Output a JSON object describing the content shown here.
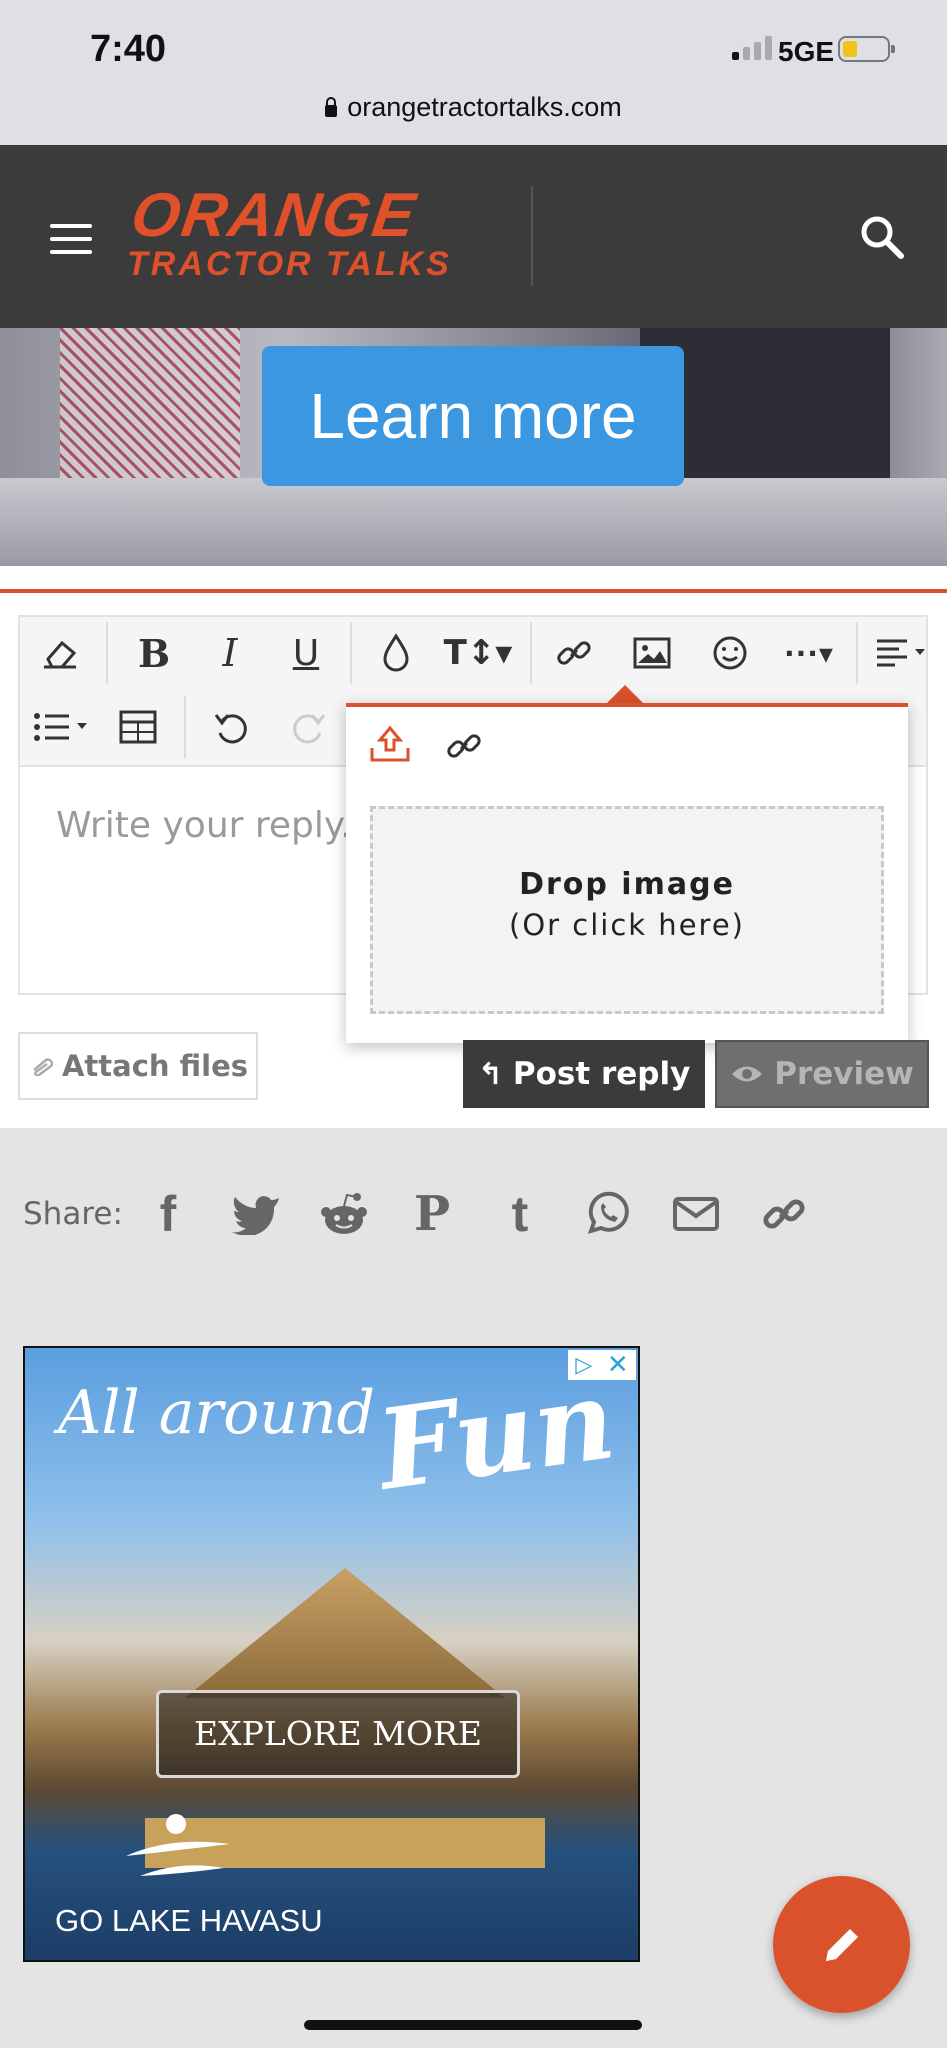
{
  "status_bar": {
    "time": "7:40",
    "network": "5GE",
    "battery_color": "#f2c21b"
  },
  "browser": {
    "url": "orangetractortalks.com"
  },
  "header": {
    "logo_line1": "ORANGE",
    "logo_line2": "TRACTOR TALKS",
    "brand_color": "#e0512b"
  },
  "banner": {
    "button_label": "Learn more"
  },
  "editor": {
    "placeholder": "Write your reply...",
    "toolbar_row1": [
      "eraser-icon",
      "bold-icon",
      "italic-icon",
      "underline-icon",
      "color-drop-icon",
      "text-size-icon",
      "link-icon",
      "image-icon",
      "smile-icon",
      "more-icon",
      "align-icon"
    ],
    "toolbar_row2": [
      "list-icon",
      "table-icon",
      "undo-icon",
      "redo-icon"
    ],
    "image_popup": {
      "drop_title": "Drop image",
      "drop_subtitle": "(Or click here)"
    }
  },
  "actions": {
    "attach": "Attach files",
    "post": "Post reply",
    "preview": "Preview"
  },
  "share": {
    "label": "Share:",
    "icons": [
      "facebook-icon",
      "twitter-icon",
      "reddit-icon",
      "pinterest-icon",
      "tumblr-icon",
      "whatsapp-icon",
      "email-icon",
      "link-icon"
    ]
  },
  "ad": {
    "line1": "All around",
    "line2": "Fun",
    "cta": "EXPLORE MORE",
    "brand": "GO LAKE HAVASU"
  },
  "accent_color": "#d9522b"
}
